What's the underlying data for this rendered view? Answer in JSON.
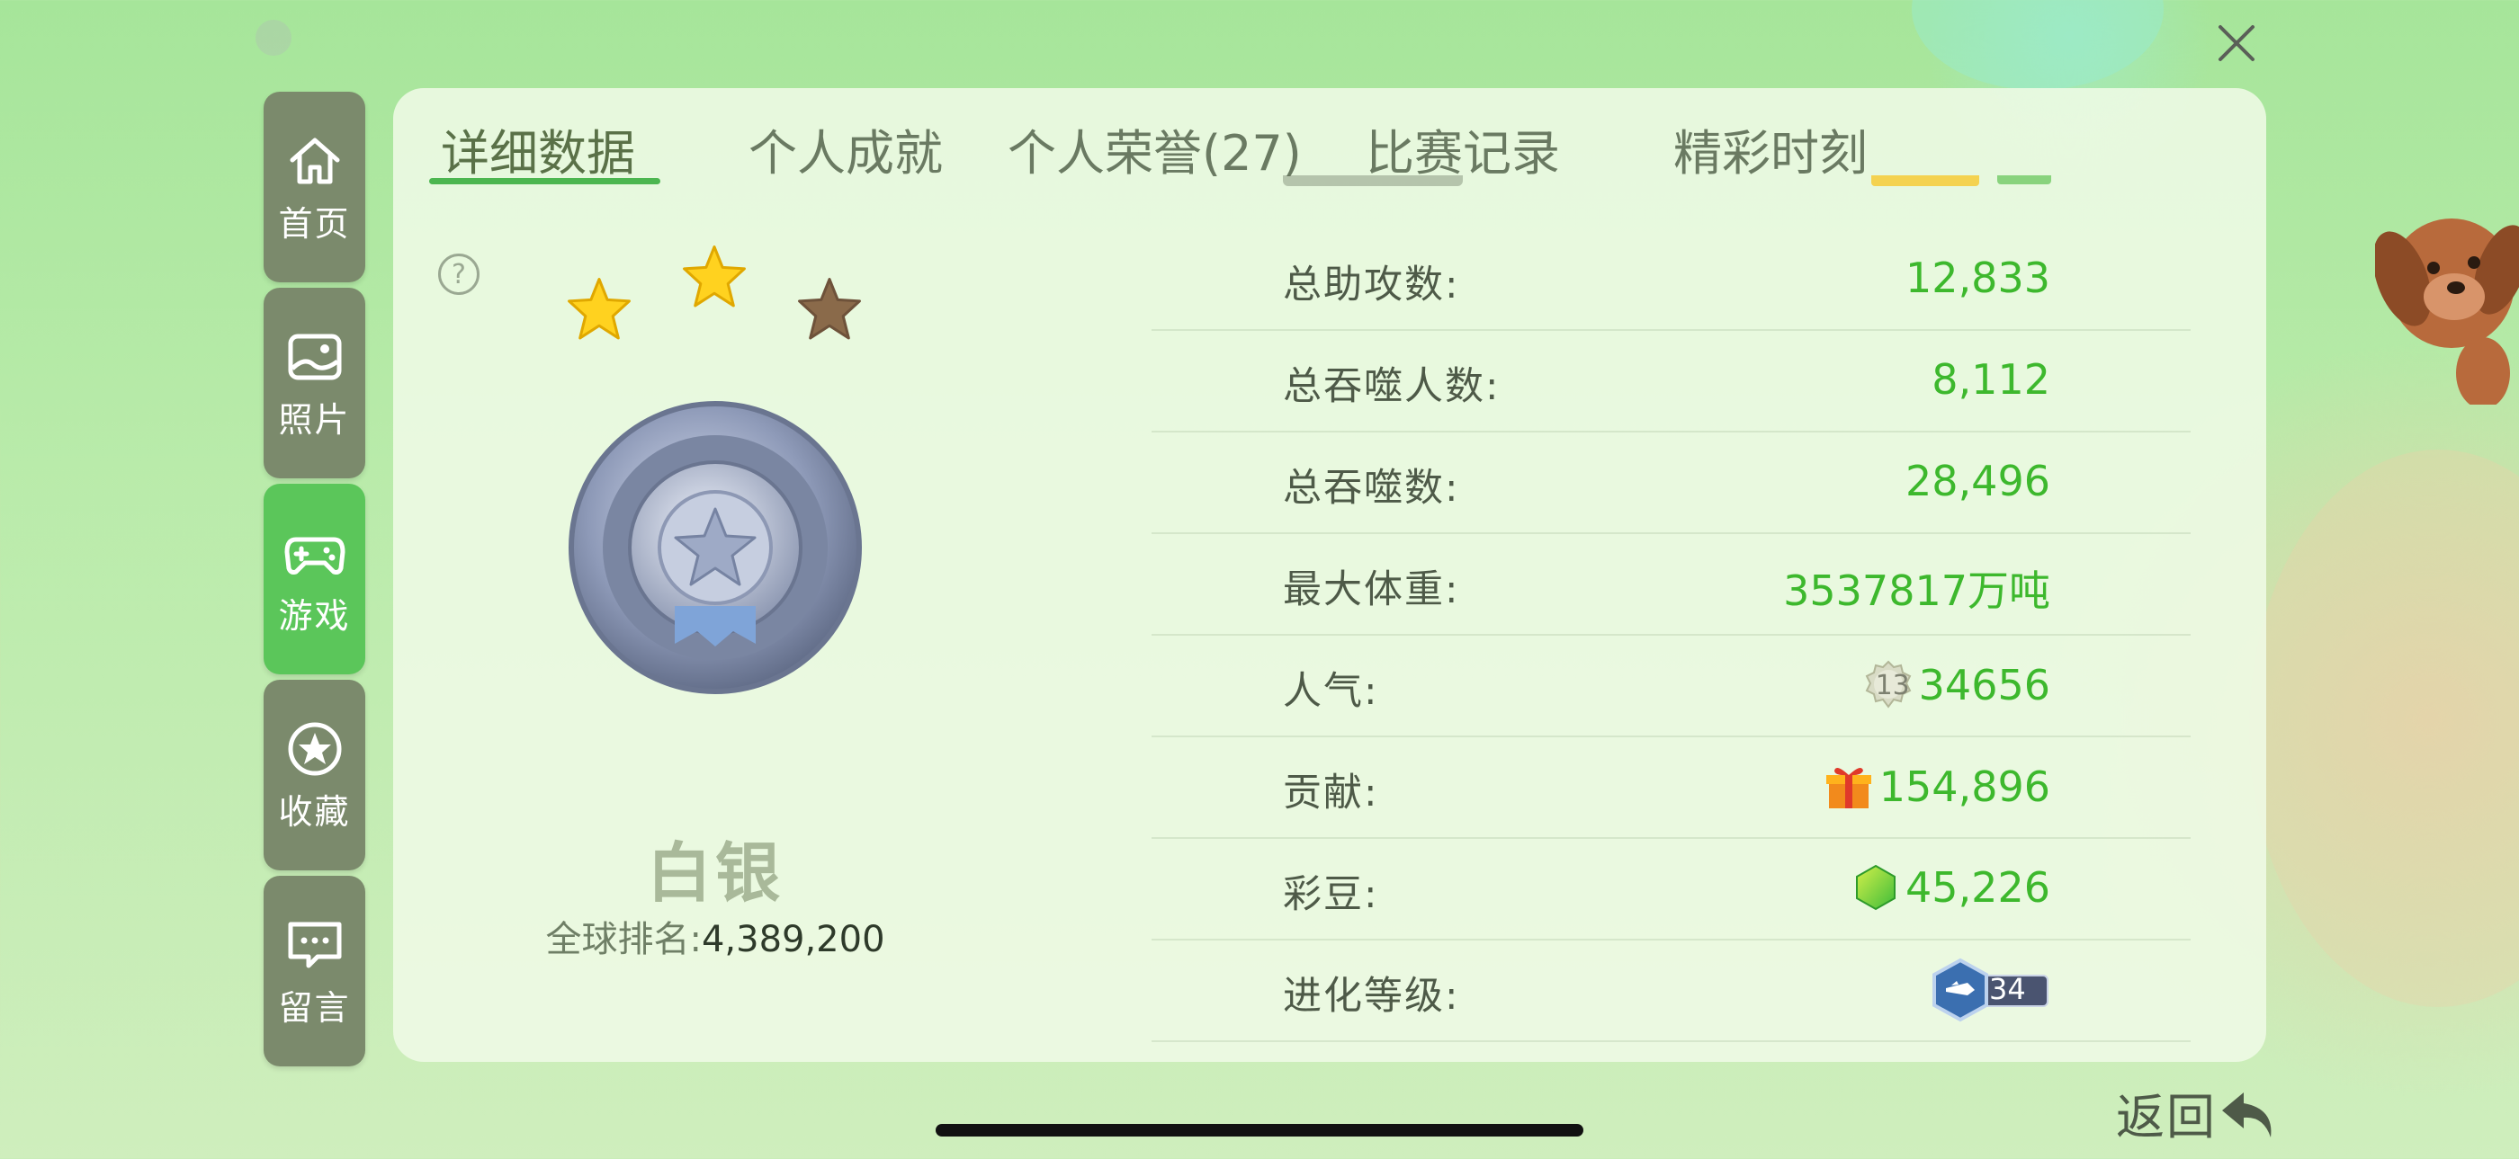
{
  "sidebar": {
    "items": [
      {
        "label": "首页",
        "icon": "home-icon"
      },
      {
        "label": "照片",
        "icon": "photo-icon"
      },
      {
        "label": "游戏",
        "icon": "gamepad-icon",
        "active": true
      },
      {
        "label": "收藏",
        "icon": "star-icon"
      },
      {
        "label": "留言",
        "icon": "message-icon"
      }
    ]
  },
  "tabs": [
    {
      "label": "详细数据",
      "active": true
    },
    {
      "label": "个人成就"
    },
    {
      "label": "个人荣誉(27)"
    },
    {
      "label": "比赛记录"
    },
    {
      "label": "精彩时刻"
    }
  ],
  "rank": {
    "stars_filled": 2,
    "stars_total": 3,
    "title": "白银",
    "global_label": "全球排名:",
    "global_value": "4,389,200"
  },
  "stats": [
    {
      "label": "总助攻数:",
      "value": "12,833"
    },
    {
      "label": "总吞噬人数:",
      "value": "8,112"
    },
    {
      "label": "总吞噬数:",
      "value": "28,496"
    },
    {
      "label": "最大体重:",
      "value": "3537817万吨"
    },
    {
      "label": "人气:",
      "value": "34656",
      "badge": "13"
    },
    {
      "label": "贡献:",
      "value": "154,896",
      "icon": "gift-icon"
    },
    {
      "label": "彩豆:",
      "value": "45,226",
      "icon": "bean-icon"
    },
    {
      "label": "进化等级:",
      "value": "",
      "badge": "34",
      "icon": "evolution-icon"
    }
  ],
  "back_label": "返回",
  "colors": {
    "accent": "#4cb650",
    "value_green": "#3db82d",
    "sidebar_bg": "#7b8a6c",
    "sidebar_active": "#5bc65a"
  }
}
